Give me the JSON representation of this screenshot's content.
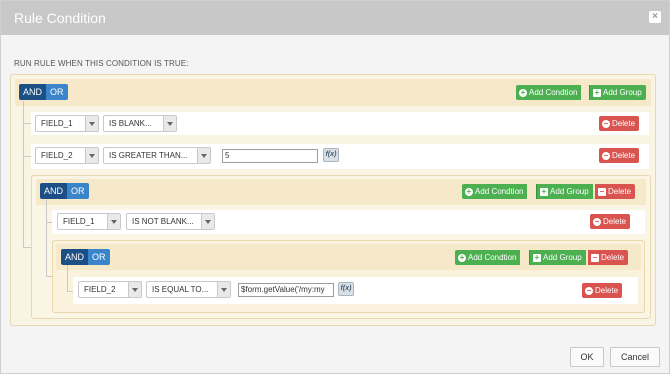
{
  "dialog": {
    "title": "Rule Condition",
    "close_glyph": "×"
  },
  "run_label": "RUN RULE WHEN THIS CONDITION IS TRUE:",
  "labels": {
    "and": "AND",
    "or": "OR",
    "add_condition": "Add Condtion",
    "add_group": "Add Group",
    "delete": "Delete",
    "fx": "f(x)"
  },
  "icons": {
    "add_condition": "plus-circle-icon",
    "add_group": "plus-square-icon",
    "delete_rule": "minus-circle-icon",
    "delete_group": "minus-square-icon",
    "close": "close-icon",
    "dropdown": "caret-down-icon"
  },
  "groups": {
    "root": {
      "rules": [
        {
          "field": "FIELD_1",
          "operator": "IS BLANK..."
        },
        {
          "field": "FIELD_2",
          "operator": "IS GREATER THAN...",
          "value": "5"
        }
      ]
    },
    "level1": {
      "rules": [
        {
          "field": "FIELD_1",
          "operator": "IS NOT BLANK..."
        }
      ]
    },
    "level2": {
      "rules": [
        {
          "field": "FIELD_2",
          "operator": "IS EQUAL TO...",
          "value": "$form.getValue('/my:my"
        }
      ]
    }
  },
  "footer": {
    "ok": "OK",
    "cancel": "Cancel"
  },
  "colors": {
    "and_active": "#1b4f86",
    "or": "#3a85c9",
    "add": "#4caf50",
    "delete": "#d9534f",
    "group_bg": "#faf4e4",
    "group_header": "#f5e9c9"
  }
}
